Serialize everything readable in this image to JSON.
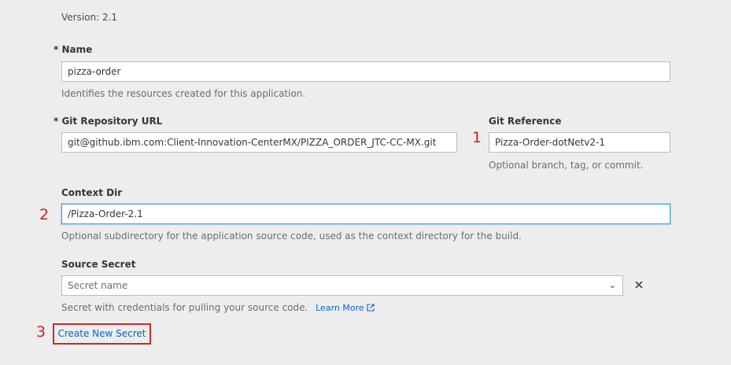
{
  "version": "Version: 2.1",
  "name": {
    "label": "* Name",
    "value": "pizza-order",
    "help": "Identifies the resources created for this application."
  },
  "git_url": {
    "label": "* Git Repository URL",
    "value": "git@github.ibm.com:Client-Innovation-CenterMX/PIZZA_ORDER_JTC-CC-MX.git"
  },
  "git_ref": {
    "label": "Git Reference",
    "value": "Pizza-Order-dotNetv2-1",
    "help": "Optional branch, tag, or commit."
  },
  "context_dir": {
    "label": "Context Dir",
    "value": "/Pizza-Order-2.1",
    "help": "Optional subdirectory for the application source code, used as the context directory for the build."
  },
  "source_secret": {
    "label": "Source Secret",
    "placeholder": "Secret name",
    "help": "Secret with credentials for pulling your source code.",
    "learn_more": "Learn More"
  },
  "create_secret_label": "Create New Secret",
  "annotations": [
    "1",
    "2",
    "3"
  ],
  "colors": {
    "background": "#ededed",
    "link": "#0066cc",
    "annotation": "#cc1f1f",
    "focus_border": "#39a5dc"
  }
}
